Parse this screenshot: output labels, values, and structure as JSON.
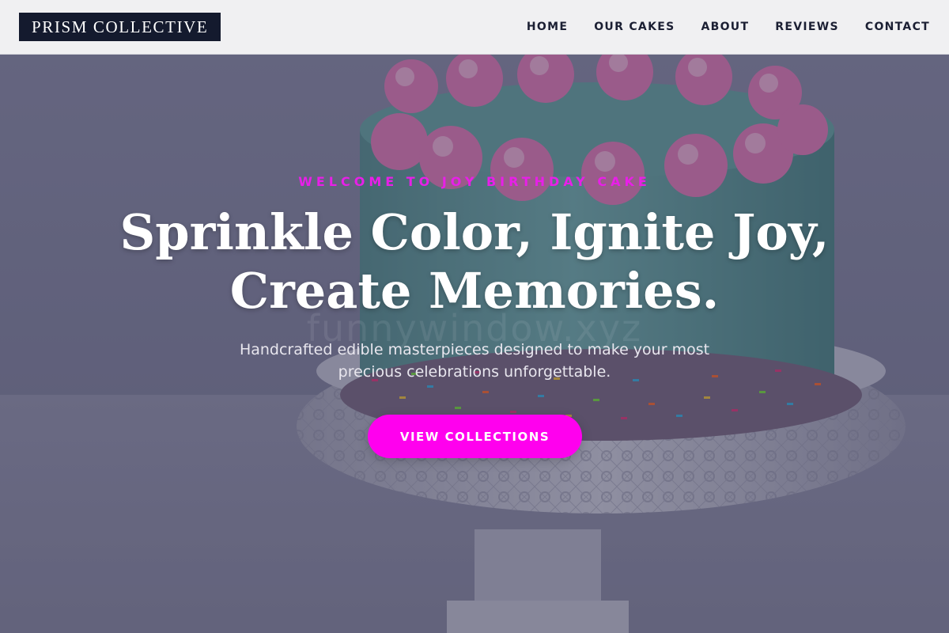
{
  "header": {
    "logo": "PRISM COLLECTIVE",
    "nav": [
      "HOME",
      "OUR CAKES",
      "ABOUT",
      "REVIEWS",
      "CONTACT"
    ]
  },
  "hero": {
    "eyebrow": "WELCOME TO JOY BIRTHDAY CAKE",
    "headline_line1": "Sprinkle Color, Ignite Joy,",
    "headline_line2": "Create Memories.",
    "subtitle": "Handcrafted edible masterpieces designed to make your most precious celebrations unforgettable.",
    "cta_label": "VIEW COLLECTIONS",
    "background_image": "birthday cake with pink frosting swirls and rainbow sprinkles on a white lace cake stand",
    "watermark": "funnywindow.xyz"
  },
  "colors": {
    "accent": "#ff00ee",
    "eyebrow": "#e81fe8",
    "logo_bg": "#141a2e",
    "header_bg": "#f0f0f2",
    "nav_text": "#1b1f33",
    "cake_frosting": "#5f9f9b",
    "frosting_swirl": "#e77db7"
  }
}
